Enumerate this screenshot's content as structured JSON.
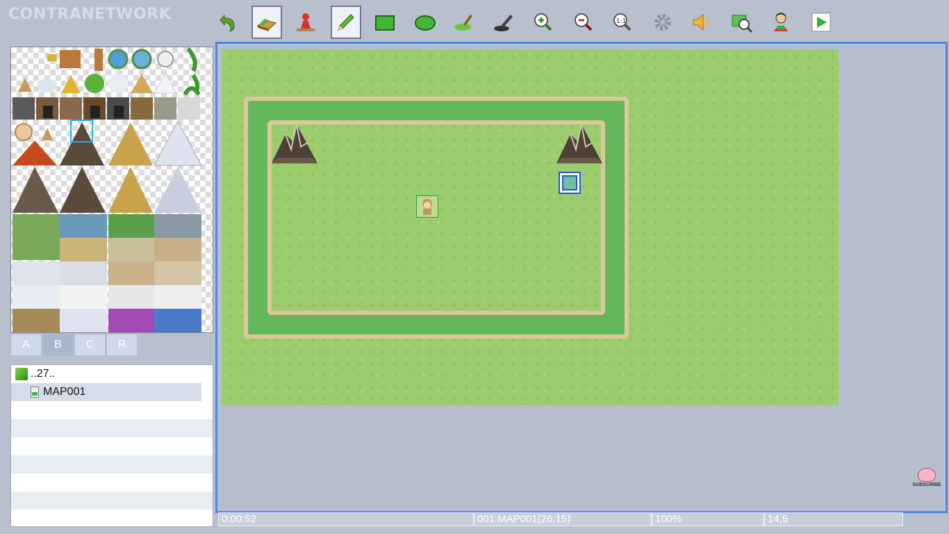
{
  "brand": "CONTRANETWORK",
  "toolbar": [
    {
      "name": "undo-icon",
      "label": "Undo"
    },
    {
      "name": "map-layer-icon",
      "label": "Map"
    },
    {
      "name": "event-layer-icon",
      "label": "Event"
    },
    {
      "name": "pencil-icon",
      "label": "Pencil"
    },
    {
      "name": "rectangle-icon",
      "label": "Rectangle"
    },
    {
      "name": "ellipse-icon",
      "label": "Ellipse"
    },
    {
      "name": "fill-icon",
      "label": "Flood Fill"
    },
    {
      "name": "shadow-pen-icon",
      "label": "Shadow Pen"
    },
    {
      "name": "zoom-in-icon",
      "label": "Zoom In"
    },
    {
      "name": "zoom-out-icon",
      "label": "Zoom Out"
    },
    {
      "name": "actual-size-icon",
      "label": "Actual Size"
    },
    {
      "name": "gear-icon",
      "label": "Settings"
    },
    {
      "name": "sound-icon",
      "label": "Sound"
    },
    {
      "name": "search-icon",
      "label": "Search"
    },
    {
      "name": "character-icon",
      "label": "Character"
    },
    {
      "name": "play-icon",
      "label": "Playtest"
    }
  ],
  "tileset_tabs": [
    "A",
    "B",
    "C",
    "R"
  ],
  "active_tab": "B",
  "maplist": {
    "project": "..27..",
    "maps": [
      "MAP001"
    ]
  },
  "status": {
    "time": "0:00:52",
    "map": "001:MAP001(26,15)",
    "zoom": "100%",
    "coords": "14,5"
  },
  "subscribe_label": "SUBSCRIBE"
}
